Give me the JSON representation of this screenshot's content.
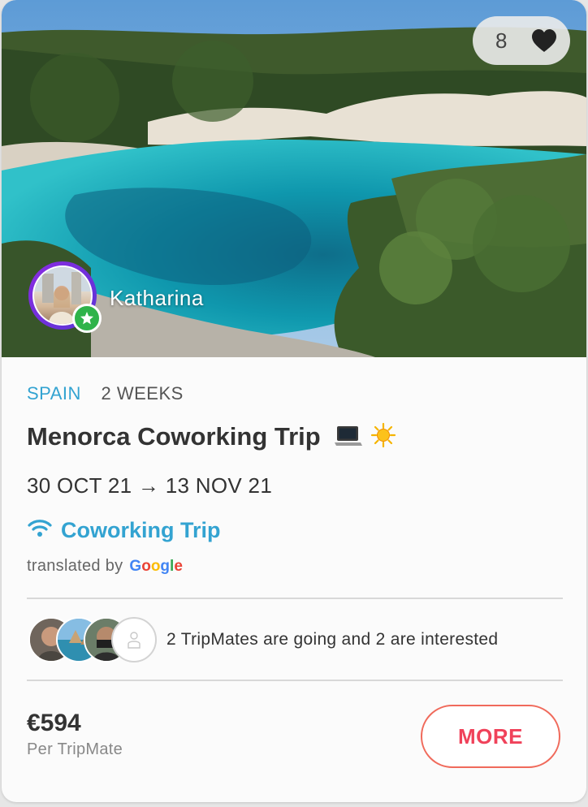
{
  "likes": {
    "count": "8",
    "icon": "heart-icon"
  },
  "host": {
    "name": "Katharina",
    "badge_icon": "star-icon"
  },
  "trip": {
    "country": "SPAIN",
    "duration": "2 WEEKS",
    "title": "Menorca Coworking Trip",
    "title_emojis": [
      "laptop-icon",
      "sun-icon"
    ],
    "dates": "30 OCT 21 → 13 NOV 21",
    "type_label": "Coworking Trip",
    "type_icon": "wifi-icon"
  },
  "translation": {
    "prefix": "translated by",
    "provider": "Google"
  },
  "tripmates": {
    "text": "2 TripMates are going and 2 are interested"
  },
  "price": {
    "amount": "€594",
    "per": "Per TripMate"
  },
  "actions": {
    "more_label": "MORE"
  },
  "colors": {
    "accent_blue": "#33a3d1",
    "more_red": "#f0425a",
    "badge_green": "#2fb34a"
  }
}
